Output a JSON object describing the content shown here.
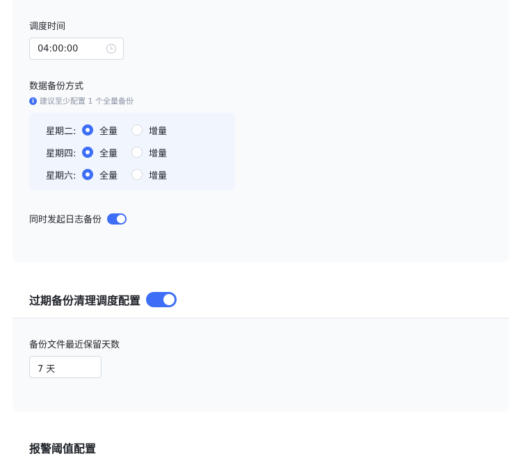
{
  "schedule": {
    "time_label": "调度时间",
    "time_value": "04:00:00"
  },
  "backup": {
    "method_label": "数据备份方式",
    "hint": "建议至少配置 1 个全量备份",
    "options": {
      "full": "全量",
      "incremental": "增量"
    },
    "rows": [
      {
        "day": "星期二:",
        "selected": "full"
      },
      {
        "day": "星期四:",
        "selected": "full"
      },
      {
        "day": "星期六:",
        "selected": "full"
      }
    ],
    "log_backup_label": "同时发起日志备份",
    "log_backup_on": true
  },
  "cleanup": {
    "title": "过期备份清理调度配置",
    "enabled": true,
    "retention_label": "备份文件最近保留天数",
    "retention_value": "7 天"
  },
  "next_section": {
    "title": "报警阈值配置"
  },
  "colors": {
    "accent": "#3d6ef5",
    "card_bg": "#f9fafc",
    "schedule_box_bg": "#f1f5fd"
  }
}
